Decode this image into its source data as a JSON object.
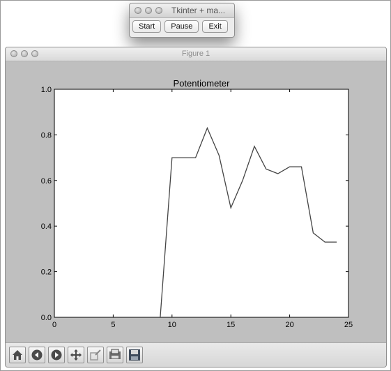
{
  "control_window": {
    "title": "Tkinter + ma...",
    "buttons": {
      "start": "Start",
      "pause": "Pause",
      "exit": "Exit"
    }
  },
  "figure_window": {
    "title": "Figure 1",
    "toolbar": [
      "home-icon",
      "back-arrow-icon",
      "forward-arrow-icon",
      "pan-move-icon",
      "zoom-to-rect-icon",
      "subplots-configure-icon",
      "save-figure-icon"
    ]
  },
  "chart_data": {
    "type": "line",
    "title": "Potentiometer",
    "xlabel": "",
    "ylabel": "",
    "xlim": [
      0,
      25
    ],
    "ylim": [
      0.0,
      1.0
    ],
    "x_ticks": [
      "0",
      "5",
      "10",
      "15",
      "20",
      "25"
    ],
    "y_ticks": [
      "0.0",
      "0.2",
      "0.4",
      "0.6",
      "0.8",
      "1.0"
    ],
    "grid": false,
    "series": [
      {
        "color": "#444444",
        "x": [
          9,
          10,
          11,
          12,
          13,
          14,
          15,
          16,
          17,
          18,
          19,
          20,
          21,
          22,
          23,
          24
        ],
        "y": [
          0.0,
          0.7,
          0.7,
          0.7,
          0.83,
          0.71,
          0.48,
          0.6,
          0.75,
          0.65,
          0.63,
          0.66,
          0.66,
          0.37,
          0.33,
          0.33
        ]
      }
    ]
  }
}
